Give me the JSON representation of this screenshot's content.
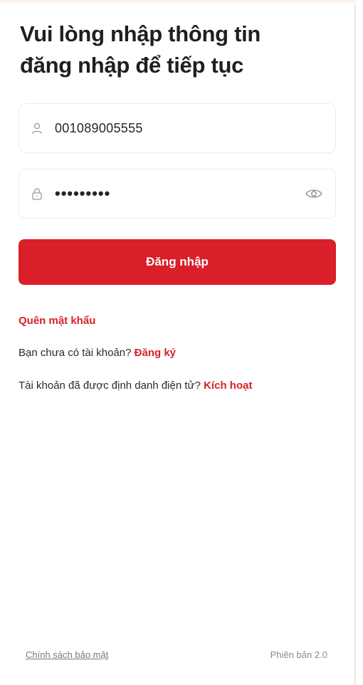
{
  "heading": {
    "line1": "Vui lòng nhập thông tin",
    "line2": "đăng nhập để tiếp tục"
  },
  "form": {
    "username": {
      "value": "001089005555",
      "icon": "user-icon"
    },
    "password": {
      "value": "•••••••••",
      "icon": "lock-icon",
      "toggle_icon": "eye-icon"
    },
    "submit_label": "Đăng nhập"
  },
  "links": {
    "forgot_password": "Quên mật khẩu",
    "register_prompt": "Bạn chưa có tài khoản?",
    "register_link": "Đăng ký",
    "activate_prompt": "Tài khoản đã được định danh điện tử?",
    "activate_link": "Kích hoạt"
  },
  "footer": {
    "privacy_policy": "Chính sách bảo mật",
    "version": "Phiên bản 2.0"
  },
  "colors": {
    "primary": "#d81f2a",
    "text": "#1f1f1f",
    "border": "#ececec"
  }
}
